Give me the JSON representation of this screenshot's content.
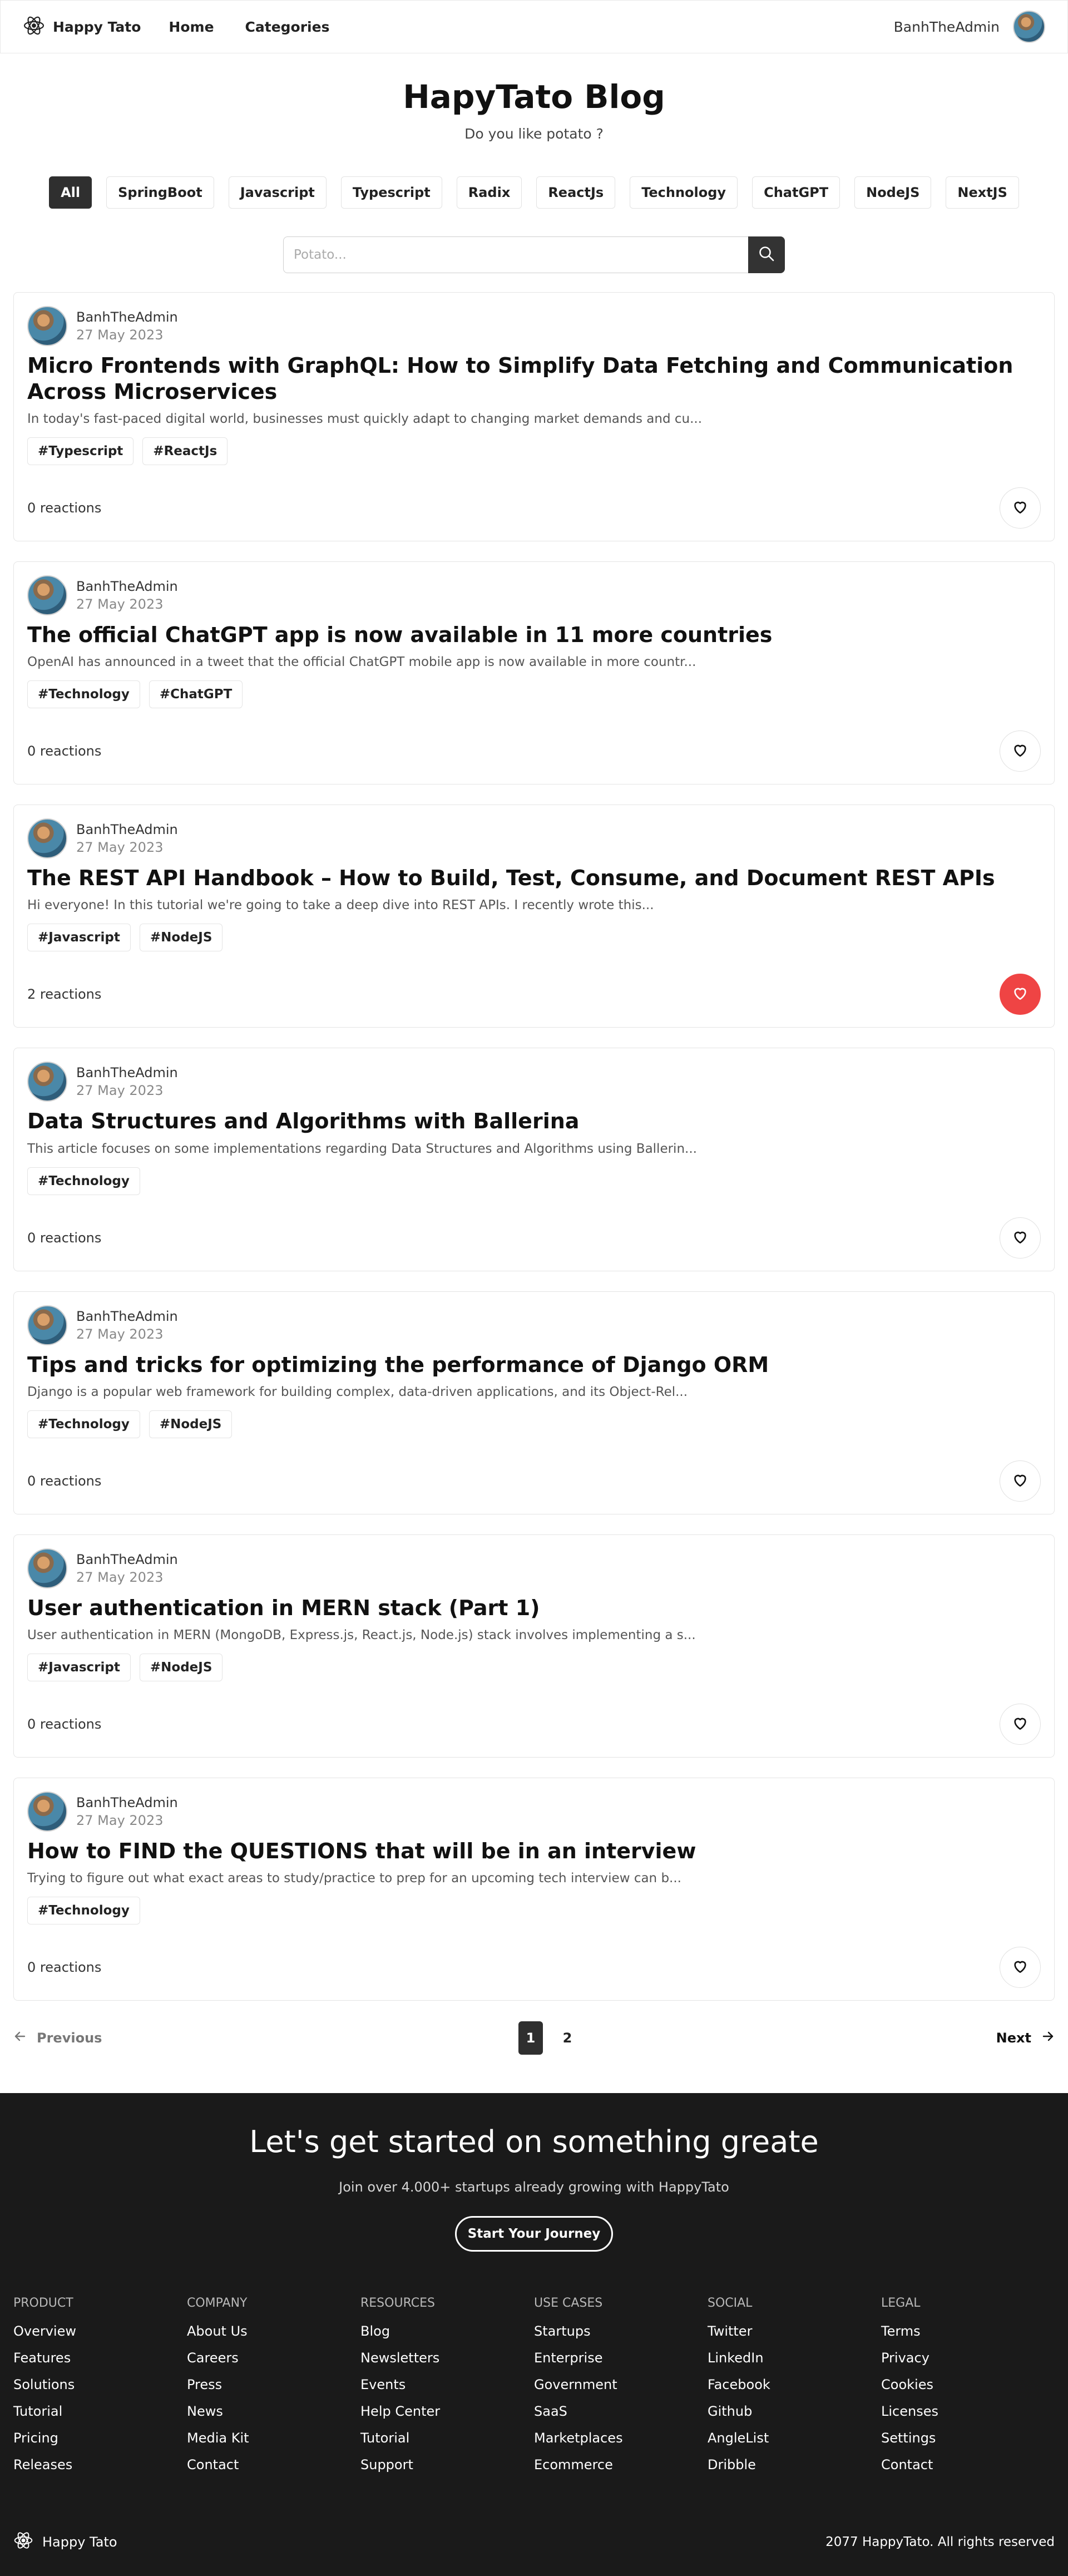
{
  "nav": {
    "brand": "Happy Tato",
    "links": [
      "Home",
      "Categories"
    ],
    "user": "BanhTheAdmin"
  },
  "hero": {
    "title": "HapyTato Blog",
    "subtitle": "Do you like potato ?"
  },
  "categories": [
    "All",
    "SpringBoot",
    "Javascript",
    "Typescript",
    "Radix",
    "ReactJs",
    "Technology",
    "ChatGPT",
    "NodeJS",
    "NextJS"
  ],
  "active_category": "All",
  "search": {
    "placeholder": "Potato..."
  },
  "posts": [
    {
      "author": "BanhTheAdmin",
      "date": "27 May 2023",
      "title": "Micro Frontends with GraphQL: How to Simplify Data Fetching and Communication Across Microservices",
      "excerpt": "In today's fast-paced digital world, businesses must quickly adapt to changing market demands and cu...",
      "tags": [
        "#Typescript",
        "#ReactJs"
      ],
      "reactions": "0 reactions",
      "liked": false
    },
    {
      "author": "BanhTheAdmin",
      "date": "27 May 2023",
      "title": "The official ChatGPT app is now available in 11 more countries",
      "excerpt": "OpenAI has announced in a tweet that the official ChatGPT mobile app is now available in more countr...",
      "tags": [
        "#Technology",
        "#ChatGPT"
      ],
      "reactions": "0 reactions",
      "liked": false
    },
    {
      "author": "BanhTheAdmin",
      "date": "27 May 2023",
      "title": "The REST API Handbook – How to Build, Test, Consume, and Document REST APIs",
      "excerpt": "Hi everyone! In this tutorial we're going to take a deep dive into REST APIs. I recently wrote this...",
      "tags": [
        "#Javascript",
        "#NodeJS"
      ],
      "reactions": "2 reactions",
      "liked": true
    },
    {
      "author": "BanhTheAdmin",
      "date": "27 May 2023",
      "title": "Data Structures and Algorithms with Ballerina",
      "excerpt": "This article focuses on some implementations regarding Data Structures and Algorithms using Ballerin...",
      "tags": [
        "#Technology"
      ],
      "reactions": "0 reactions",
      "liked": false
    },
    {
      "author": "BanhTheAdmin",
      "date": "27 May 2023",
      "title": "Tips and tricks for optimizing the performance of Django ORM",
      "excerpt": "Django is a popular web framework for building complex, data-driven applications, and its Object-Rel...",
      "tags": [
        "#Technology",
        "#NodeJS"
      ],
      "reactions": "0 reactions",
      "liked": false
    },
    {
      "author": "BanhTheAdmin",
      "date": "27 May 2023",
      "title": "User authentication in MERN stack (Part 1)",
      "excerpt": "User authentication in MERN (MongoDB, Express.js, React.js, Node.js) stack involves implementing a s...",
      "tags": [
        "#Javascript",
        "#NodeJS"
      ],
      "reactions": "0 reactions",
      "liked": false
    },
    {
      "author": "BanhTheAdmin",
      "date": "27 May 2023",
      "title": "How to FIND the QUESTIONS that will be in an interview",
      "excerpt": "Trying to figure out what exact areas to study/practice to prep for an upcoming tech interview can b...",
      "tags": [
        "#Technology"
      ],
      "reactions": "0 reactions",
      "liked": false
    }
  ],
  "pagination": {
    "prev": "Previous",
    "next": "Next",
    "pages": [
      "1",
      "2"
    ],
    "current": "1"
  },
  "footer": {
    "cta_title": "Let's get started on something greate",
    "cta_subtitle": "Join over 4.000+ startups already growing with HappyTato",
    "cta_button": "Start Your Journey",
    "columns": [
      {
        "heading": "PRODUCT",
        "links": [
          "Overview",
          "Features",
          "Solutions",
          "Tutorial",
          "Pricing",
          "Releases"
        ]
      },
      {
        "heading": "COMPANY",
        "links": [
          "About Us",
          "Careers",
          "Press",
          "News",
          "Media Kit",
          "Contact"
        ]
      },
      {
        "heading": "RESOURCES",
        "links": [
          "Blog",
          "Newsletters",
          "Events",
          "Help Center",
          "Tutorial",
          "Support"
        ]
      },
      {
        "heading": "USE CASES",
        "links": [
          "Startups",
          "Enterprise",
          "Government",
          "SaaS",
          "Marketplaces",
          "Ecommerce"
        ]
      },
      {
        "heading": "SOCIAL",
        "links": [
          "Twitter",
          "LinkedIn",
          "Facebook",
          "Github",
          "AngleList",
          "Dribble"
        ]
      },
      {
        "heading": "LEGAL",
        "links": [
          "Terms",
          "Privacy",
          "Cookies",
          "Licenses",
          "Settings",
          "Contact"
        ]
      }
    ],
    "brand": "Happy Tato",
    "copyright": "2077 HappyTato. All rights reserved"
  },
  "colors": {
    "liked": "#ef4444",
    "dark": "#2f2f2f",
    "footer_bg": "#1a1a1a"
  },
  "icons": {
    "brand": "react-atom-icon",
    "search": "search-icon",
    "heart": "heart-icon",
    "prev": "arrow-left-icon",
    "next": "arrow-right-icon"
  }
}
